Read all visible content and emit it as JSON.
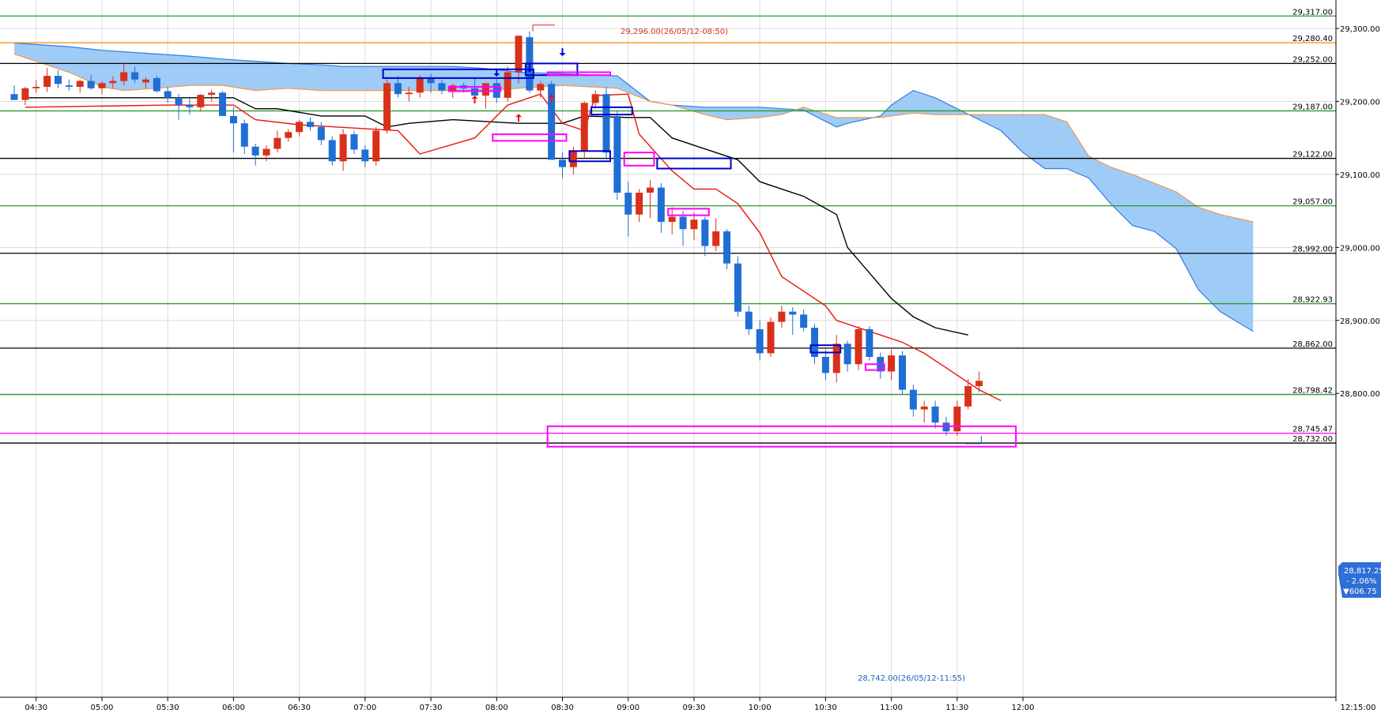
{
  "chart_data": {
    "type": "candlestick",
    "bar_minutes": 5,
    "x_ticks": [
      "04:30",
      "05:00",
      "05:30",
      "06:00",
      "06:30",
      "07:00",
      "07:30",
      "08:00",
      "08:30",
      "09:00",
      "09:30",
      "10:00",
      "10:30",
      "11:00",
      "11:30",
      "12:00",
      "12:15:00"
    ],
    "y_ticks": [
      29300,
      29200,
      29100,
      29000,
      28900,
      28800
    ],
    "y_tick_labels": [
      "29,300.00",
      "29,200.00",
      "29,100.00",
      "29,000.00",
      "28,900.00",
      "28,800.00"
    ],
    "ylim": [
      28700,
      29320
    ],
    "grid": true,
    "levels": [
      {
        "value": 29317,
        "label": "29,317.00",
        "color": "#2e9a2e"
      },
      {
        "value": 29280.4,
        "label": "29,280.40",
        "color": "#ff8800"
      },
      {
        "value": 29252,
        "label": "29,252.00",
        "color": "#000000"
      },
      {
        "value": 29187,
        "label": "29,187.00",
        "color": "#2e9a2e"
      },
      {
        "value": 29122,
        "label": "29,122.00",
        "color": "#000000"
      },
      {
        "value": 29057,
        "label": "29,057.00",
        "color": "#2e9a2e"
      },
      {
        "value": 28992,
        "label": "28,992.00",
        "color": "#000000"
      },
      {
        "value": 28922.93,
        "label": "28,922.93",
        "color": "#2e9a2e"
      },
      {
        "value": 28862,
        "label": "28,862.00",
        "color": "#000000"
      },
      {
        "value": 28798.42,
        "label": "28,798.42",
        "color": "#2e9a2e"
      },
      {
        "value": 28745.47,
        "label": "28,745.47",
        "color": "#ff00ff"
      },
      {
        "value": 28732,
        "label": "28,732.00",
        "color": "#000000"
      }
    ],
    "candles": [
      {
        "t": "04:20",
        "o": 29210,
        "h": 29222,
        "l": 29203,
        "c": 29202
      },
      {
        "t": "04:25",
        "o": 29202,
        "h": 29220,
        "l": 29195,
        "c": 29218
      },
      {
        "t": "04:30",
        "o": 29218,
        "h": 29229,
        "l": 29212,
        "c": 29220
      },
      {
        "t": "04:35",
        "o": 29220,
        "h": 29246,
        "l": 29213,
        "c": 29235
      },
      {
        "t": "04:40",
        "o": 29235,
        "h": 29243,
        "l": 29218,
        "c": 29224
      },
      {
        "t": "04:45",
        "o": 29222,
        "h": 29230,
        "l": 29215,
        "c": 29220
      },
      {
        "t": "04:50",
        "o": 29220,
        "h": 29230,
        "l": 29212,
        "c": 29228
      },
      {
        "t": "04:55",
        "o": 29228,
        "h": 29236,
        "l": 29216,
        "c": 29218
      },
      {
        "t": "05:00",
        "o": 29218,
        "h": 29228,
        "l": 29210,
        "c": 29225
      },
      {
        "t": "05:05",
        "o": 29225,
        "h": 29234,
        "l": 29218,
        "c": 29228
      },
      {
        "t": "05:10",
        "o": 29228,
        "h": 29252,
        "l": 29222,
        "c": 29240
      },
      {
        "t": "05:15",
        "o": 29240,
        "h": 29248,
        "l": 29225,
        "c": 29230
      },
      {
        "t": "05:20",
        "o": 29226,
        "h": 29233,
        "l": 29218,
        "c": 29230
      },
      {
        "t": "05:25",
        "o": 29232,
        "h": 29235,
        "l": 29212,
        "c": 29214
      },
      {
        "t": "05:30",
        "o": 29214,
        "h": 29220,
        "l": 29198,
        "c": 29205
      },
      {
        "t": "05:35",
        "o": 29205,
        "h": 29210,
        "l": 29175,
        "c": 29195
      },
      {
        "t": "05:40",
        "o": 29195,
        "h": 29205,
        "l": 29182,
        "c": 29192
      },
      {
        "t": "05:45",
        "o": 29192,
        "h": 29210,
        "l": 29186,
        "c": 29209
      },
      {
        "t": "05:50",
        "o": 29209,
        "h": 29216,
        "l": 29200,
        "c": 29212
      },
      {
        "t": "05:55",
        "o": 29212,
        "h": 29214,
        "l": 29195,
        "c": 29180
      },
      {
        "t": "06:00",
        "o": 29180,
        "h": 29192,
        "l": 29130,
        "c": 29170
      },
      {
        "t": "06:05",
        "o": 29170,
        "h": 29175,
        "l": 29128,
        "c": 29138
      },
      {
        "t": "06:10",
        "o": 29138,
        "h": 29142,
        "l": 29112,
        "c": 29126
      },
      {
        "t": "06:15",
        "o": 29126,
        "h": 29140,
        "l": 29118,
        "c": 29135
      },
      {
        "t": "06:20",
        "o": 29135,
        "h": 29160,
        "l": 29130,
        "c": 29150
      },
      {
        "t": "06:25",
        "o": 29150,
        "h": 29162,
        "l": 29145,
        "c": 29158
      },
      {
        "t": "06:30",
        "o": 29158,
        "h": 29175,
        "l": 29152,
        "c": 29172
      },
      {
        "t": "06:35",
        "o": 29172,
        "h": 29178,
        "l": 29160,
        "c": 29165
      },
      {
        "t": "06:40",
        "o": 29165,
        "h": 29172,
        "l": 29140,
        "c": 29147
      },
      {
        "t": "06:45",
        "o": 29147,
        "h": 29152,
        "l": 29112,
        "c": 29118
      },
      {
        "t": "06:50",
        "o": 29118,
        "h": 29162,
        "l": 29105,
        "c": 29155
      },
      {
        "t": "06:55",
        "o": 29155,
        "h": 29160,
        "l": 29128,
        "c": 29134
      },
      {
        "t": "07:00",
        "o": 29134,
        "h": 29140,
        "l": 29110,
        "c": 29118
      },
      {
        "t": "07:05",
        "o": 29118,
        "h": 29165,
        "l": 29112,
        "c": 29160
      },
      {
        "t": "07:10",
        "o": 29160,
        "h": 29230,
        "l": 29156,
        "c": 29225
      },
      {
        "t": "07:15",
        "o": 29225,
        "h": 29235,
        "l": 29205,
        "c": 29210
      },
      {
        "t": "07:20",
        "o": 29210,
        "h": 29220,
        "l": 29200,
        "c": 29212
      },
      {
        "t": "07:25",
        "o": 29212,
        "h": 29236,
        "l": 29205,
        "c": 29233
      },
      {
        "t": "07:30",
        "o": 29233,
        "h": 29238,
        "l": 29212,
        "c": 29225
      },
      {
        "t": "07:35",
        "o": 29225,
        "h": 29230,
        "l": 29210,
        "c": 29215
      },
      {
        "t": "07:40",
        "o": 29215,
        "h": 29224,
        "l": 29205,
        "c": 29222
      },
      {
        "t": "07:45",
        "o": 29222,
        "h": 29226,
        "l": 29212,
        "c": 29218
      },
      {
        "t": "07:50",
        "o": 29218,
        "h": 29232,
        "l": 29210,
        "c": 29208
      },
      {
        "t": "07:55",
        "o": 29208,
        "h": 29218,
        "l": 29190,
        "c": 29225
      },
      {
        "t": "08:00",
        "o": 29225,
        "h": 29232,
        "l": 29198,
        "c": 29205
      },
      {
        "t": "08:05",
        "o": 29205,
        "h": 29248,
        "l": 29200,
        "c": 29240
      },
      {
        "t": "08:10",
        "o": 29240,
        "h": 29290,
        "l": 29225,
        "c": 29290
      },
      {
        "t": "08:15",
        "o": 29288,
        "h": 29296,
        "l": 29212,
        "c": 29215
      },
      {
        "t": "08:20",
        "o": 29215,
        "h": 29228,
        "l": 29205,
        "c": 29224
      },
      {
        "t": "08:25",
        "o": 29224,
        "h": 29228,
        "l": 29140,
        "c": 29120
      },
      {
        "t": "08:30",
        "o": 29120,
        "h": 29130,
        "l": 29095,
        "c": 29110
      },
      {
        "t": "08:35",
        "o": 29110,
        "h": 29138,
        "l": 29100,
        "c": 29132
      },
      {
        "t": "08:40",
        "o": 29132,
        "h": 29200,
        "l": 29122,
        "c": 29198
      },
      {
        "t": "08:45",
        "o": 29198,
        "h": 29215,
        "l": 29190,
        "c": 29210
      },
      {
        "t": "08:50",
        "o": 29210,
        "h": 29220,
        "l": 29120,
        "c": 29130
      },
      {
        "t": "08:55",
        "o": 29180,
        "h": 29188,
        "l": 29065,
        "c": 29075
      },
      {
        "t": "09:00",
        "o": 29075,
        "h": 29090,
        "l": 29015,
        "c": 29045
      },
      {
        "t": "09:05",
        "o": 29045,
        "h": 29080,
        "l": 29035,
        "c": 29075
      },
      {
        "t": "09:10",
        "o": 29075,
        "h": 29092,
        "l": 29040,
        "c": 29082
      },
      {
        "t": "09:15",
        "o": 29082,
        "h": 29088,
        "l": 29020,
        "c": 29035
      },
      {
        "t": "09:20",
        "o": 29035,
        "h": 29055,
        "l": 29018,
        "c": 29042
      },
      {
        "t": "09:25",
        "o": 29042,
        "h": 29050,
        "l": 29002,
        "c": 29025
      },
      {
        "t": "09:30",
        "o": 29025,
        "h": 29048,
        "l": 29010,
        "c": 29038
      },
      {
        "t": "09:35",
        "o": 29038,
        "h": 29042,
        "l": 28988,
        "c": 29002
      },
      {
        "t": "09:40",
        "o": 29002,
        "h": 29040,
        "l": 28995,
        "c": 29022
      },
      {
        "t": "09:45",
        "o": 29022,
        "h": 29025,
        "l": 28970,
        "c": 28978
      },
      {
        "t": "09:50",
        "o": 28978,
        "h": 28988,
        "l": 28905,
        "c": 28912
      },
      {
        "t": "09:55",
        "o": 28912,
        "h": 28920,
        "l": 28880,
        "c": 28888
      },
      {
        "t": "10:00",
        "o": 28888,
        "h": 28900,
        "l": 28845,
        "c": 28855
      },
      {
        "t": "10:05",
        "o": 28855,
        "h": 28904,
        "l": 28850,
        "c": 28898
      },
      {
        "t": "10:10",
        "o": 28898,
        "h": 28920,
        "l": 28890,
        "c": 28912
      },
      {
        "t": "10:15",
        "o": 28912,
        "h": 28918,
        "l": 28880,
        "c": 28908
      },
      {
        "t": "10:20",
        "o": 28908,
        "h": 28915,
        "l": 28885,
        "c": 28890
      },
      {
        "t": "10:25",
        "o": 28890,
        "h": 28895,
        "l": 28840,
        "c": 28850
      },
      {
        "t": "10:30",
        "o": 28850,
        "h": 28860,
        "l": 28818,
        "c": 28828
      },
      {
        "t": "10:35",
        "o": 28828,
        "h": 28880,
        "l": 28815,
        "c": 28868
      },
      {
        "t": "10:40",
        "o": 28868,
        "h": 28872,
        "l": 28830,
        "c": 28840
      },
      {
        "t": "10:45",
        "o": 28840,
        "h": 28892,
        "l": 28832,
        "c": 28888
      },
      {
        "t": "10:50",
        "o": 28888,
        "h": 28892,
        "l": 28845,
        "c": 28850
      },
      {
        "t": "10:55",
        "o": 28850,
        "h": 28856,
        "l": 28820,
        "c": 28830
      },
      {
        "t": "11:00",
        "o": 28830,
        "h": 28860,
        "l": 28818,
        "c": 28852
      },
      {
        "t": "11:05",
        "o": 28852,
        "h": 28858,
        "l": 28798,
        "c": 28805
      },
      {
        "t": "11:10",
        "o": 28805,
        "h": 28812,
        "l": 28768,
        "c": 28778
      },
      {
        "t": "11:15",
        "o": 28778,
        "h": 28790,
        "l": 28760,
        "c": 28782
      },
      {
        "t": "11:20",
        "o": 28782,
        "h": 28790,
        "l": 28752,
        "c": 28760
      },
      {
        "t": "11:25",
        "o": 28760,
        "h": 28768,
        "l": 28742,
        "c": 28748
      },
      {
        "t": "11:30",
        "o": 28748,
        "h": 28790,
        "l": 28742,
        "c": 28782
      },
      {
        "t": "11:35",
        "o": 28782,
        "h": 28820,
        "l": 28778,
        "c": 28810
      },
      {
        "t": "11:40",
        "o": 28810,
        "h": 28830,
        "l": 28802,
        "c": 28817.25
      }
    ],
    "tenkan": [
      [
        1,
        29192
      ],
      [
        14,
        29195
      ],
      [
        20,
        29195
      ],
      [
        22,
        29175
      ],
      [
        26,
        29168
      ],
      [
        35,
        29160
      ],
      [
        37,
        29128
      ],
      [
        42,
        29150
      ],
      [
        45,
        29195
      ],
      [
        48,
        29210
      ],
      [
        50,
        29170
      ],
      [
        52,
        29160
      ],
      [
        53,
        29208
      ],
      [
        56,
        29210
      ],
      [
        57,
        29155
      ],
      [
        60,
        29105
      ],
      [
        62,
        29080
      ],
      [
        64,
        29080
      ],
      [
        66,
        29060
      ],
      [
        68,
        29020
      ],
      [
        70,
        28960
      ],
      [
        72,
        28940
      ],
      [
        74,
        28920
      ],
      [
        75,
        28900
      ],
      [
        79,
        28880
      ],
      [
        81,
        28870
      ],
      [
        83,
        28855
      ],
      [
        85,
        28835
      ],
      [
        88,
        28805
      ],
      [
        90,
        28790
      ]
    ],
    "kijun": [
      [
        1,
        29205
      ],
      [
        14,
        29205
      ],
      [
        20,
        29205
      ],
      [
        22,
        29190
      ],
      [
        24,
        29190
      ],
      [
        28,
        29180
      ],
      [
        32,
        29180
      ],
      [
        34,
        29165
      ],
      [
        36,
        29170
      ],
      [
        40,
        29175
      ],
      [
        46,
        29170
      ],
      [
        50,
        29170
      ],
      [
        52,
        29180
      ],
      [
        56,
        29178
      ],
      [
        58,
        29178
      ],
      [
        60,
        29150
      ],
      [
        66,
        29120
      ],
      [
        68,
        29090
      ],
      [
        70,
        29080
      ],
      [
        72,
        29070
      ],
      [
        75,
        29045
      ],
      [
        76,
        29000
      ],
      [
        78,
        28965
      ],
      [
        80,
        28930
      ],
      [
        82,
        28905
      ],
      [
        84,
        28890
      ],
      [
        87,
        28880
      ]
    ],
    "cloud": {
      "x": [
        0,
        5,
        8,
        10,
        13,
        16,
        19,
        22,
        25,
        28,
        30,
        32,
        34,
        36,
        40,
        43,
        46,
        50,
        55,
        58,
        60,
        63,
        65,
        68,
        70,
        72,
        75,
        76,
        79,
        80,
        82,
        84,
        86,
        88,
        90,
        92,
        94,
        96,
        98,
        100,
        102,
        104,
        106,
        108,
        110,
        113
      ],
      "span_a": [
        29265,
        29240,
        29220,
        29215,
        29218,
        29222,
        29222,
        29215,
        29218,
        29215,
        29215,
        29215,
        29215,
        29215,
        29215,
        29215,
        29218,
        29222,
        29218,
        29200,
        29195,
        29182,
        29175,
        29178,
        29182,
        29192,
        29178,
        29178,
        29178,
        29180,
        29184,
        29182,
        29182,
        29182,
        29182,
        29182,
        29182,
        29172,
        29125,
        29110,
        29100,
        29088,
        29076,
        29055,
        29045,
        29035
      ],
      "span_b": [
        29280,
        29275,
        29270,
        29268,
        29265,
        29262,
        29258,
        29255,
        29252,
        29250,
        29248,
        29248,
        29248,
        29248,
        29248,
        29245,
        29240,
        29238,
        29235,
        29200,
        29195,
        29192,
        29192,
        29192,
        29190,
        29188,
        29165,
        29170,
        29180,
        29195,
        29215,
        29205,
        29190,
        29175,
        29160,
        29130,
        29108,
        29108,
        29095,
        29060,
        29030,
        29022,
        28998,
        28942,
        28912,
        28885
      ]
    },
    "boxes": [
      {
        "a": 34,
        "b": 47,
        "top": 29244,
        "bot": 29232,
        "color": "#0000cc"
      },
      {
        "a": 47,
        "b": 51,
        "top": 29252,
        "bot": 29236,
        "color": "#0000cc"
      },
      {
        "a": 53,
        "b": 56,
        "top": 29192,
        "bot": 29182,
        "color": "#0000cc"
      },
      {
        "a": 51,
        "b": 54,
        "top": 29132,
        "bot": 29118,
        "color": "#0000cc"
      },
      {
        "a": 59,
        "b": 65,
        "top": 29122,
        "bot": 29108,
        "color": "#0000cc"
      },
      {
        "a": 73,
        "b": 75,
        "top": 28866,
        "bot": 28856,
        "color": "#0000cc"
      },
      {
        "a": 40,
        "b": 44,
        "top": 29220,
        "bot": 29214,
        "color": "#ff00ff"
      },
      {
        "a": 49,
        "b": 54,
        "top": 29240,
        "bot": 29236,
        "color": "#ff00ff"
      },
      {
        "a": 44,
        "b": 50,
        "top": 29155,
        "bot": 29146,
        "color": "#ff00ff"
      },
      {
        "a": 56,
        "b": 58,
        "top": 29130,
        "bot": 29112,
        "color": "#ff00ff"
      },
      {
        "a": 60,
        "b": 63,
        "top": 29053,
        "bot": 29044,
        "color": "#ff00ff"
      },
      {
        "a": 78,
        "b": 79,
        "top": 28840,
        "bot": 28832,
        "color": "#ff00ff"
      },
      {
        "a": 49,
        "b": 91,
        "top": 28755,
        "bot": 28727,
        "color": "#ff00ff"
      }
    ],
    "arrows_down": [
      [
        44,
        29234
      ],
      [
        47,
        29240
      ],
      [
        50,
        29262
      ]
    ],
    "arrows_up": [
      [
        42,
        29208
      ],
      [
        46,
        29183
      ],
      [
        49,
        29210
      ]
    ],
    "high_note": "29,296.00(26/05/12-08:50)",
    "low_note": "28,742.00(26/05/12-11:55)",
    "current": {
      "price": "28,817.25",
      "change_pct": "- 2.06%",
      "change_abs": "▼606.75"
    }
  }
}
